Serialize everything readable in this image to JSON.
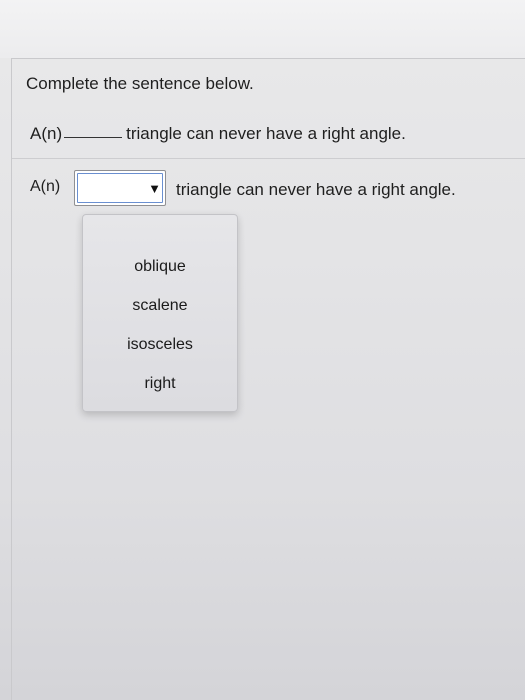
{
  "question": {
    "instruction": "Complete the sentence below.",
    "sentence_1": {
      "prefix": "A(n)",
      "suffix": "triangle can never have a right angle."
    },
    "sentence_2": {
      "prefix": "A(n)",
      "selected_value": "",
      "arrow_icon": "triangle-down-icon",
      "arrow_glyph": "▼",
      "suffix": "triangle can never have a right angle."
    }
  },
  "dropdown": {
    "options": [
      "oblique",
      "scalene",
      "isosceles",
      "right"
    ]
  }
}
